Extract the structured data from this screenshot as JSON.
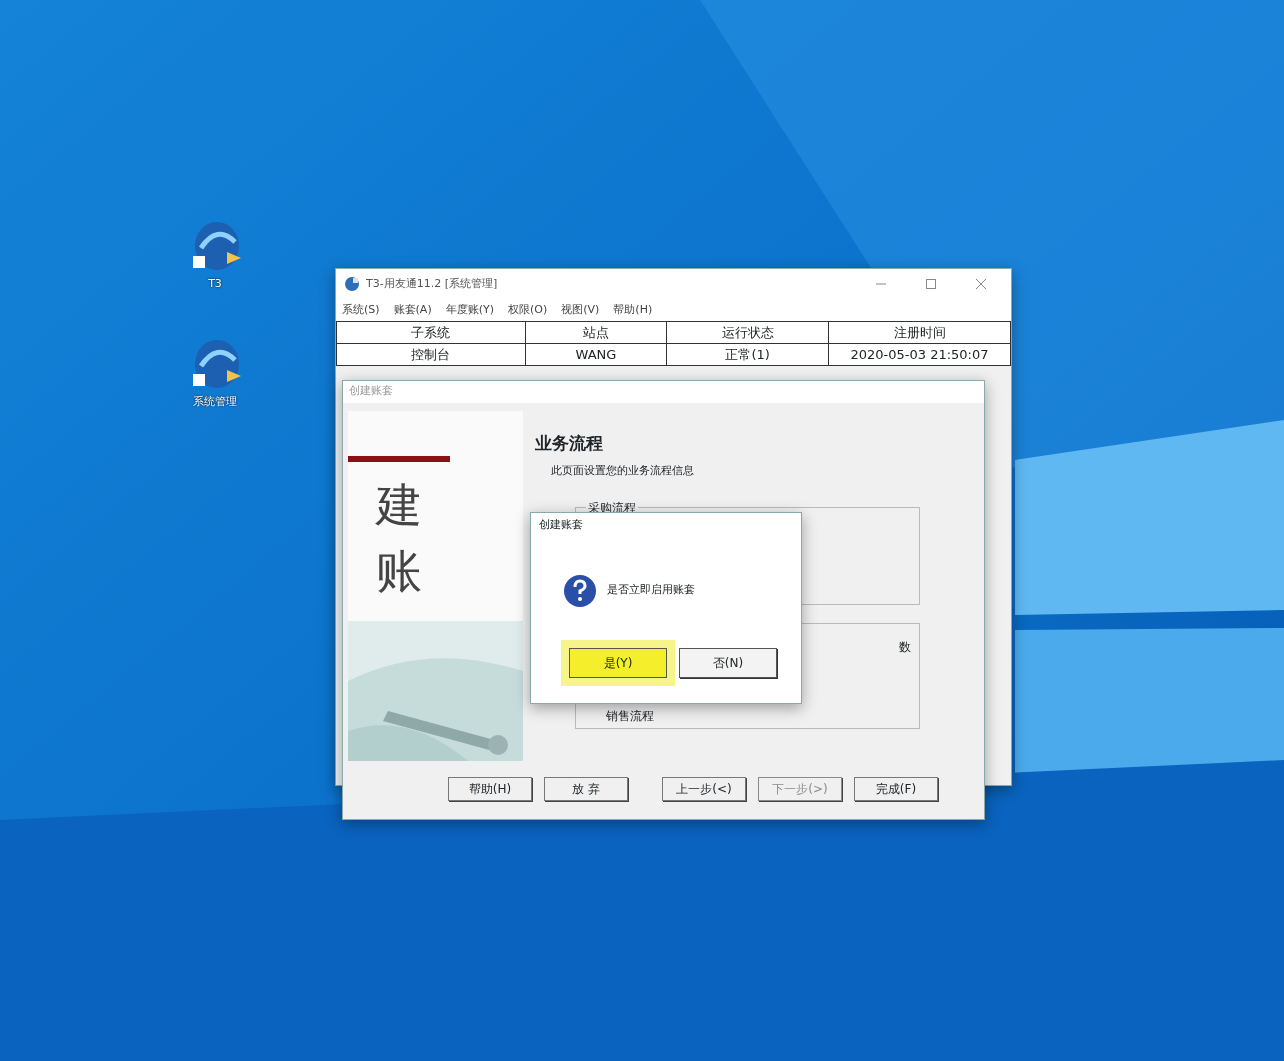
{
  "desktop": {
    "icons": [
      {
        "label": "T3"
      },
      {
        "label": "系统管理"
      }
    ]
  },
  "main_window": {
    "title": "T3-用友通11.2 [系统管理]",
    "menu": [
      "系统(S)",
      "账套(A)",
      "年度账(Y)",
      "权限(O)",
      "视图(V)",
      "帮助(H)"
    ],
    "table": {
      "columns": [
        "子系统",
        "站点",
        "运行状态",
        "注册时间"
      ],
      "rows": [
        [
          "控制台",
          "WANG",
          "正常(1)",
          "2020-05-03 21:50:07"
        ]
      ]
    }
  },
  "wizard": {
    "title": "创建账套",
    "banner": [
      "建",
      "账"
    ],
    "heading": "业务流程",
    "subtitle": "此页面设置您的业务流程信息",
    "groups": [
      {
        "label": "采购流程"
      },
      {
        "lines": [
          "数",
          "销售流程"
        ]
      }
    ],
    "buttons": [
      {
        "label": "帮助(H)",
        "disabled": false
      },
      {
        "label": "放 弃",
        "disabled": false
      },
      {
        "label": "上一步(<)",
        "disabled": false
      },
      {
        "label": "下一步(>)",
        "disabled": true
      },
      {
        "label": "完成(F)",
        "disabled": false
      }
    ]
  },
  "dialog": {
    "title": "创建账套",
    "message": "是否立即启用账套",
    "buttons": [
      {
        "label": "是(Y)",
        "selected": true
      },
      {
        "label": "否(N)",
        "selected": false
      }
    ]
  }
}
